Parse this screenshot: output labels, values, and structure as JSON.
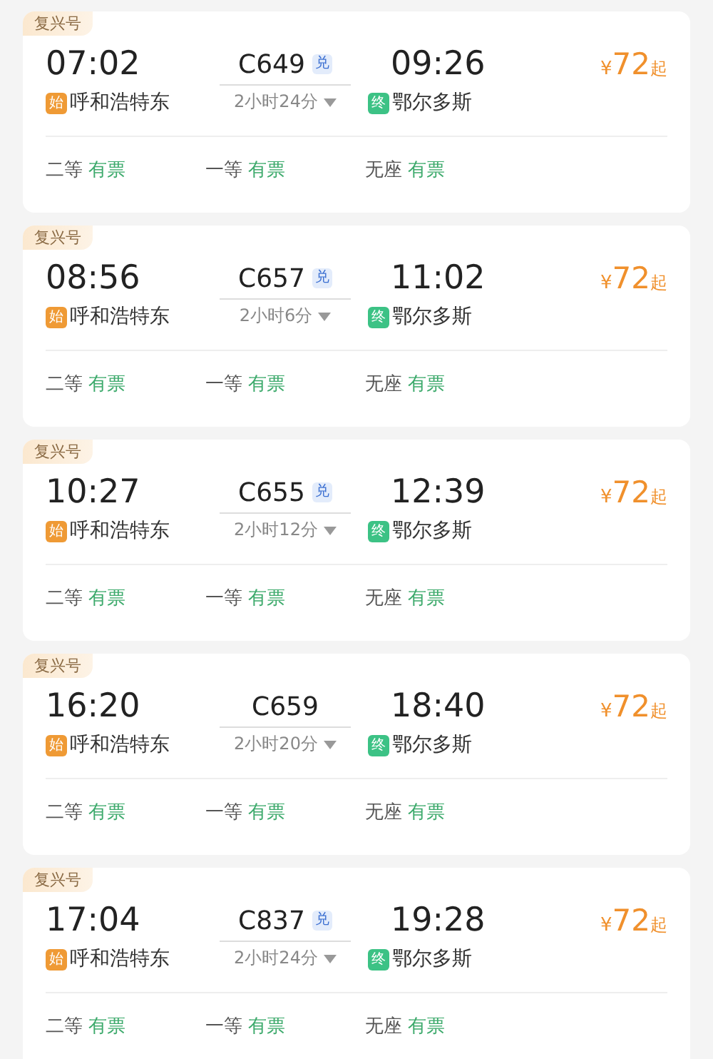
{
  "trains": [
    {
      "type_label": "复兴号",
      "depart_time": "07:02",
      "train_no": "C649",
      "exchange": true,
      "exchange_label": "兑",
      "arrive_time": "09:26",
      "from_tag": "始",
      "from": "呼和浩特东",
      "duration": "2小时24分",
      "to_tag": "终",
      "to": "鄂尔多斯",
      "price_symbol": "¥",
      "price": "72",
      "price_suffix": "起",
      "seats": [
        {
          "class": "二等",
          "status": "有票"
        },
        {
          "class": "一等",
          "status": "有票"
        },
        {
          "class": "无座",
          "status": "有票"
        }
      ]
    },
    {
      "type_label": "复兴号",
      "depart_time": "08:56",
      "train_no": "C657",
      "exchange": true,
      "exchange_label": "兑",
      "arrive_time": "11:02",
      "from_tag": "始",
      "from": "呼和浩特东",
      "duration": "2小时6分",
      "to_tag": "终",
      "to": "鄂尔多斯",
      "price_symbol": "¥",
      "price": "72",
      "price_suffix": "起",
      "seats": [
        {
          "class": "二等",
          "status": "有票"
        },
        {
          "class": "一等",
          "status": "有票"
        },
        {
          "class": "无座",
          "status": "有票"
        }
      ]
    },
    {
      "type_label": "复兴号",
      "depart_time": "10:27",
      "train_no": "C655",
      "exchange": true,
      "exchange_label": "兑",
      "arrive_time": "12:39",
      "from_tag": "始",
      "from": "呼和浩特东",
      "duration": "2小时12分",
      "to_tag": "终",
      "to": "鄂尔多斯",
      "price_symbol": "¥",
      "price": "72",
      "price_suffix": "起",
      "seats": [
        {
          "class": "二等",
          "status": "有票"
        },
        {
          "class": "一等",
          "status": "有票"
        },
        {
          "class": "无座",
          "status": "有票"
        }
      ]
    },
    {
      "type_label": "复兴号",
      "depart_time": "16:20",
      "train_no": "C659",
      "exchange": false,
      "arrive_time": "18:40",
      "from_tag": "始",
      "from": "呼和浩特东",
      "duration": "2小时20分",
      "to_tag": "终",
      "to": "鄂尔多斯",
      "price_symbol": "¥",
      "price": "72",
      "price_suffix": "起",
      "seats": [
        {
          "class": "二等",
          "status": "有票"
        },
        {
          "class": "一等",
          "status": "有票"
        },
        {
          "class": "无座",
          "status": "有票"
        }
      ]
    },
    {
      "type_label": "复兴号",
      "depart_time": "17:04",
      "train_no": "C837",
      "exchange": true,
      "exchange_label": "兑",
      "arrive_time": "19:28",
      "from_tag": "始",
      "from": "呼和浩特东",
      "duration": "2小时24分",
      "to_tag": "终",
      "to": "鄂尔多斯",
      "price_symbol": "¥",
      "price": "72",
      "price_suffix": "起",
      "seats": [
        {
          "class": "二等",
          "status": "有票"
        },
        {
          "class": "一等",
          "status": "有票"
        },
        {
          "class": "无座",
          "status": "有票"
        }
      ]
    }
  ]
}
